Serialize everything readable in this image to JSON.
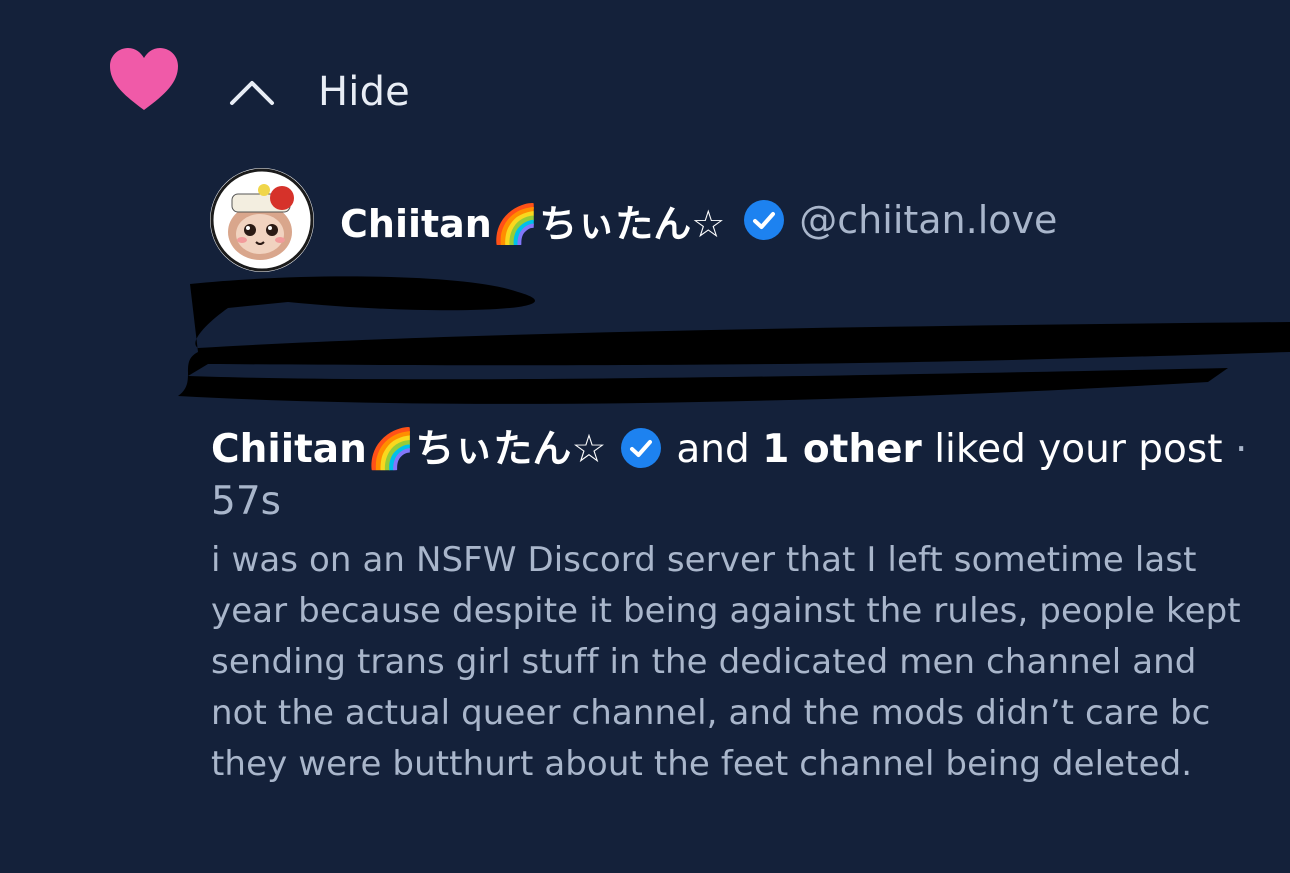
{
  "notification": {
    "like_icon": "heart-icon",
    "like_color": "#f05aa8",
    "hide_label": "Hide",
    "hide_icon": "chevron-up-icon"
  },
  "user": {
    "display_name": "Chiitan",
    "display_name_rainbow": "🌈",
    "display_name_jp": "ちぃたん",
    "display_name_star": "☆",
    "verified_icon": "verified-check-icon",
    "verified_color": "#1d82f0",
    "handle": "@chiitan.love"
  },
  "summary": {
    "actor_name": "Chiitan",
    "actor_rainbow": "🌈",
    "actor_jp": "ちぃたん",
    "actor_star": "☆",
    "and_text": "and",
    "others_count": "1 other",
    "liked_text": "liked your post",
    "separator": "·",
    "time_ago": "57s"
  },
  "post": {
    "text": "i was on an NSFW Discord server that I left sometime last year because despite it being against the rules, people kept sending trans girl stuff in the dedicated men channel and not the actual queer channel, and the mods didn’t care bc they were butthurt about the feet channel being deleted."
  }
}
